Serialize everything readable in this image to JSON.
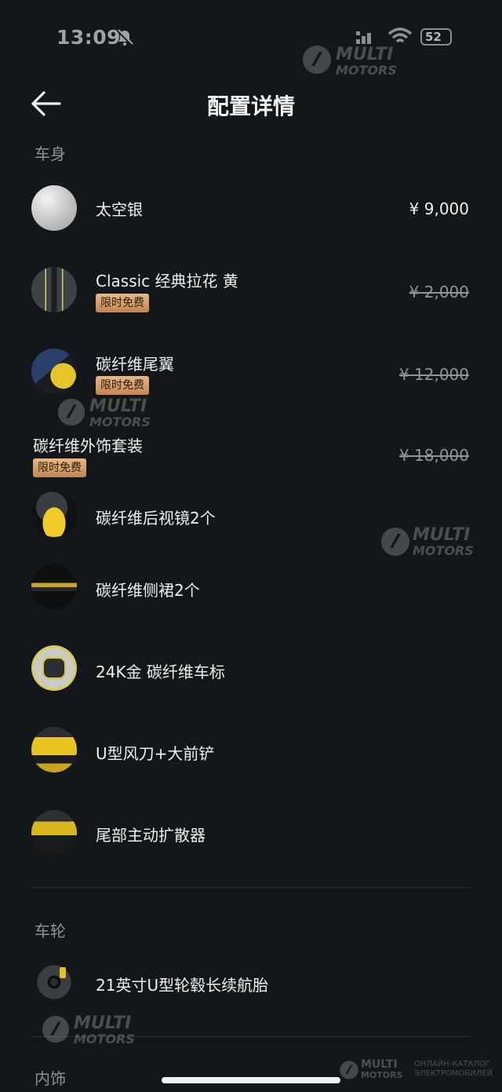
{
  "status": {
    "time": "13:09",
    "battery": "52"
  },
  "header": {
    "title": "配置详情"
  },
  "sections": {
    "body": "车身",
    "wheels": "车轮",
    "interior": "内饰"
  },
  "items": [
    {
      "name": "太空银",
      "price": "¥ 9,000",
      "badge": ""
    },
    {
      "name": "Classic 经典拉花 黄",
      "price": "¥ 2,000",
      "badge": "限时免费"
    },
    {
      "name": "碳纤维尾翼",
      "price": "¥ 12,000",
      "badge": "限时免费"
    },
    {
      "name": "碳纤维外饰套装",
      "price": "¥ 18,000",
      "badge": "限时免费"
    },
    {
      "name": "碳纤维后视镜2个"
    },
    {
      "name": "碳纤维侧裙2个"
    },
    {
      "name": "24K金 碳纤维车标"
    },
    {
      "name": "U型风刀+大前铲"
    },
    {
      "name": "尾部主动扩散器"
    },
    {
      "name": "21英寸U型轮毂长续航胎"
    }
  ],
  "watermark": {
    "brand_top": "MULTI",
    "brand_bottom": "MOTORS",
    "caption_1": "ОНЛАЙН-КАТАЛОГ",
    "caption_2": "ЭЛЕКТРОМОБИЛЕЙ"
  },
  "colors": {
    "background": "#131719",
    "badge": "#d9a672",
    "muted": "#8e9395"
  }
}
